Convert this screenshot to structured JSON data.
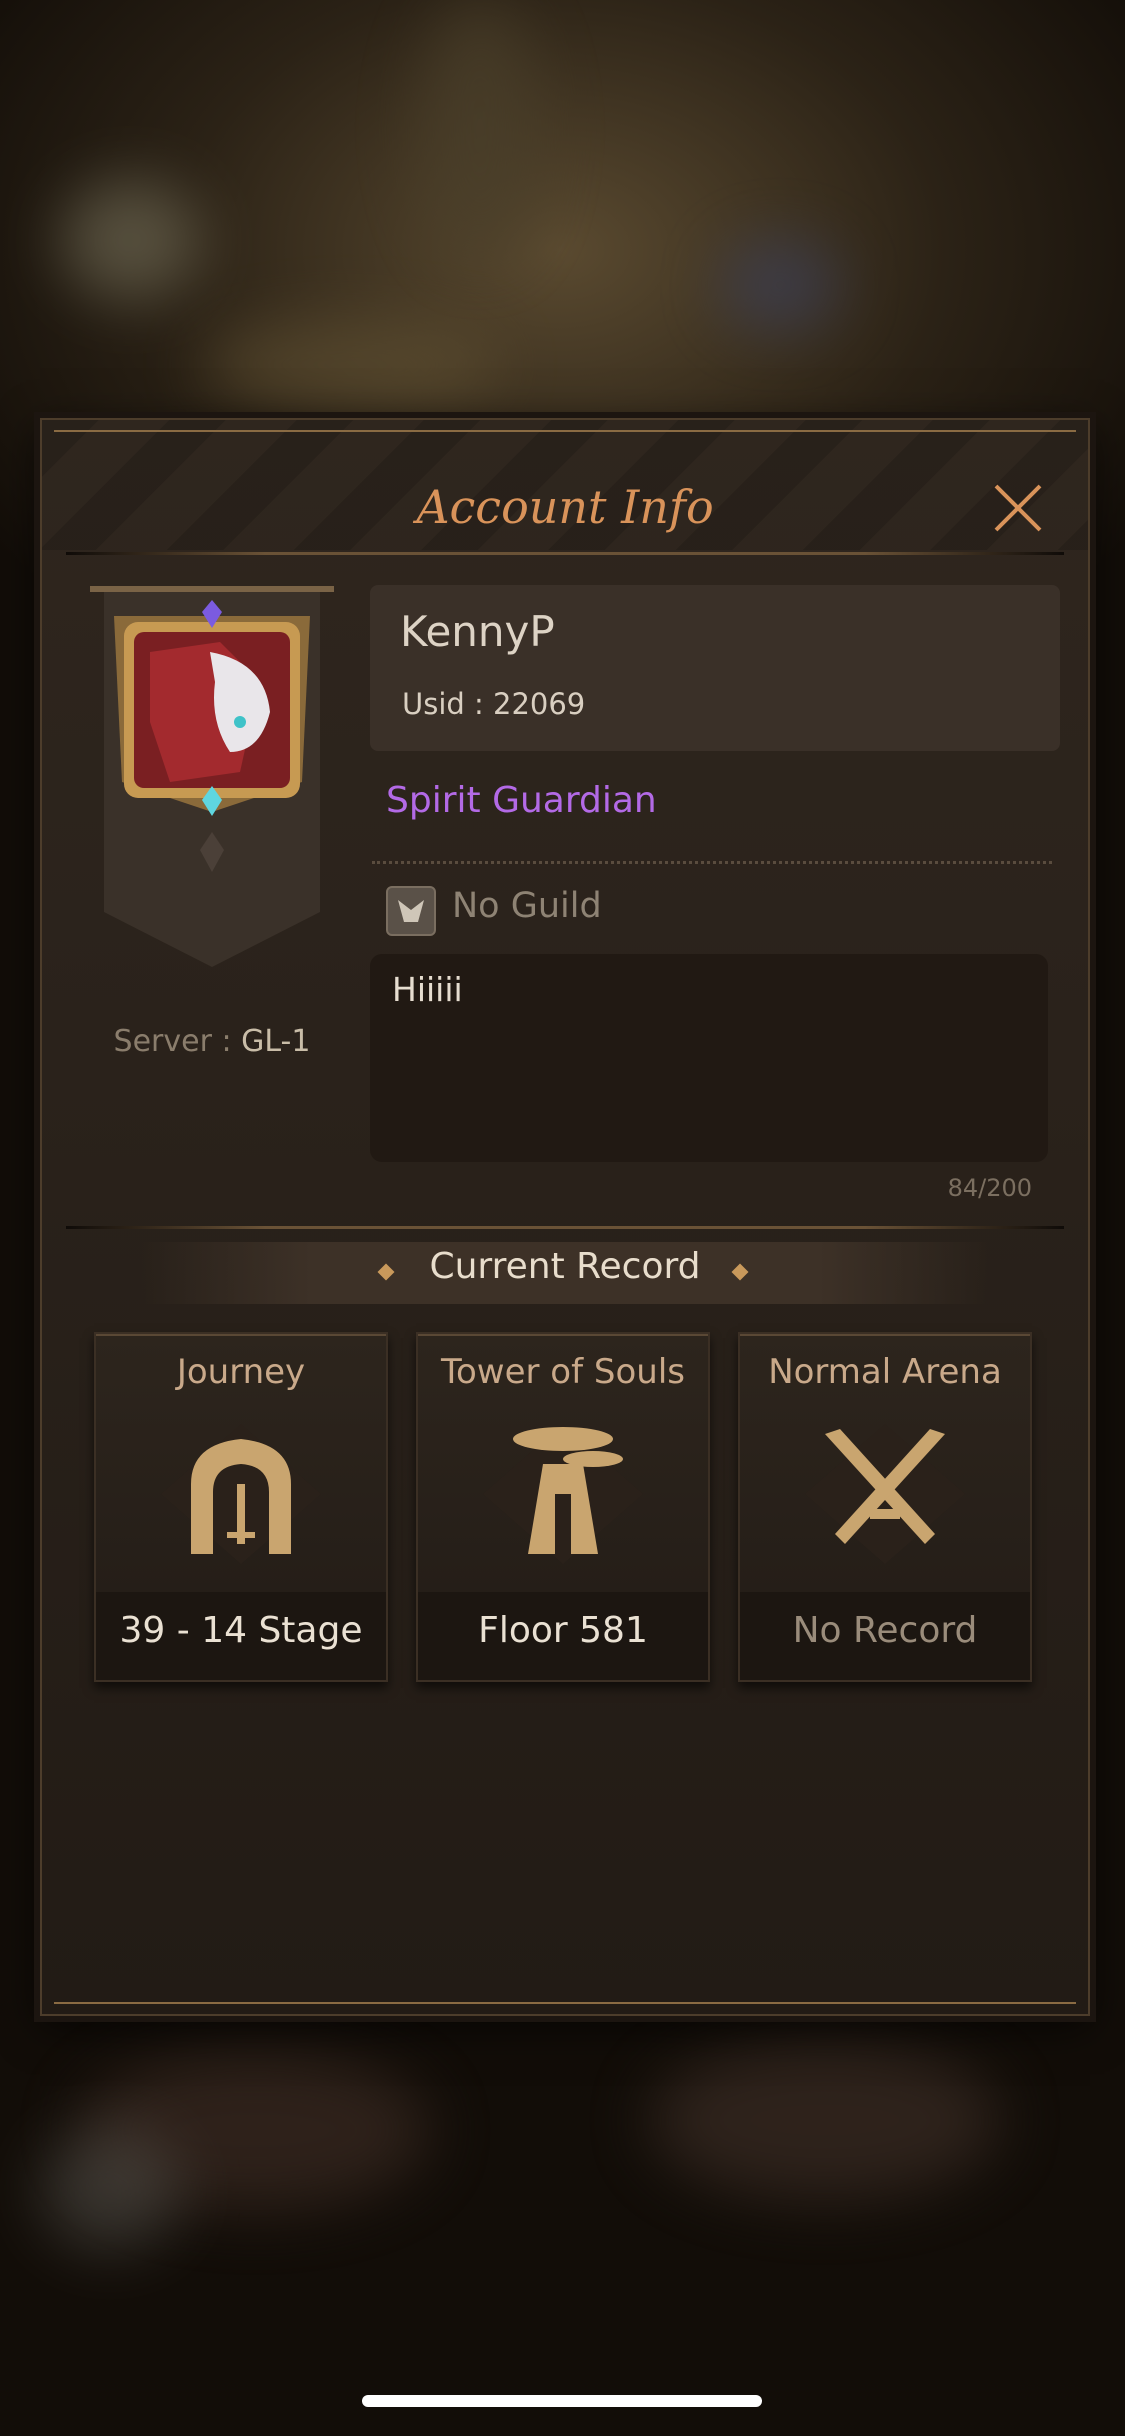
{
  "dialog": {
    "title": "Account Info",
    "close_icon": "close-icon"
  },
  "profile": {
    "name": "KennyP",
    "usid": "Usid : 22069",
    "rank": "Spirit Guardian",
    "guild": "No Guild",
    "server_label": "Server : ",
    "server_value": "GL-1",
    "motto": "Hiiiii",
    "motto_count": "84/200"
  },
  "record": {
    "title": "Current Record",
    "cards": [
      {
        "label": "Journey",
        "value": "39 - 14 Stage",
        "icon": "gate-sword-icon"
      },
      {
        "label": "Tower of Souls",
        "value": "Floor 581",
        "icon": "tower-icon"
      },
      {
        "label": "Normal Arena",
        "value": "No Record",
        "icon": "crossed-swords-icon"
      }
    ]
  },
  "colors": {
    "title": "#d9935a",
    "rank": "#b36ae6",
    "panel": "#2a221b"
  }
}
